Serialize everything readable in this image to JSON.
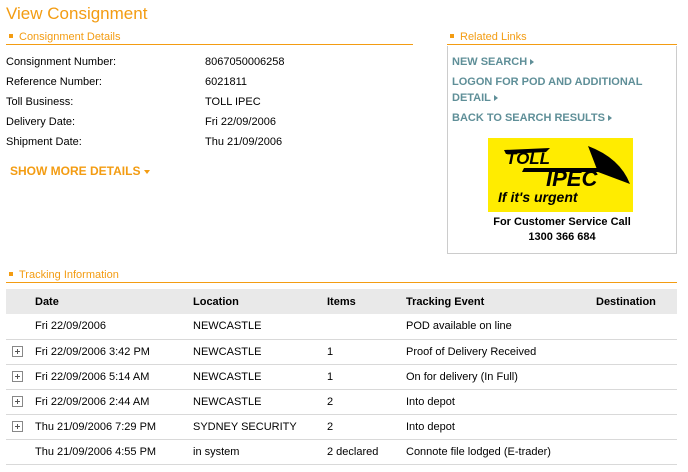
{
  "page_title": "View Consignment",
  "consignment_section": {
    "heading": "Consignment Details",
    "fields": [
      {
        "label": "Consignment Number:",
        "value": "8067050006258"
      },
      {
        "label": "Reference Number:",
        "value": "6021811"
      },
      {
        "label": "Toll Business:",
        "value": "TOLL IPEC"
      },
      {
        "label": "Delivery Date:",
        "value": "Fri 22/09/2006"
      },
      {
        "label": "Shipment Date:",
        "value": "Thu 21/09/2006"
      }
    ],
    "show_more_label": "SHOW MORE DETAILS"
  },
  "related_links": {
    "heading": "Related Links",
    "links": [
      {
        "label": "NEW SEARCH"
      },
      {
        "label_line1": "LOGON FOR POD AND ADDITIONAL",
        "label_line2": "DETAIL"
      },
      {
        "label": "BACK TO SEARCH RESULTS"
      }
    ],
    "logo": {
      "line1": "TOLL",
      "line2": "IPEC",
      "tagline": "If it's urgent"
    },
    "customer_service_label": "For Customer Service Call",
    "customer_service_phone": "1300 366 684"
  },
  "tracking_section": {
    "heading": "Tracking Information",
    "columns": [
      "Date",
      "Location",
      "Items",
      "Tracking Event",
      "Destination"
    ],
    "rows": [
      {
        "expandable": false,
        "date": "Fri 22/09/2006",
        "location": "NEWCASTLE",
        "items": "",
        "event": "POD available on line",
        "destination": ""
      },
      {
        "expandable": true,
        "date": "Fri 22/09/2006 3:42 PM",
        "location": "NEWCASTLE",
        "items": "1",
        "event": "Proof of Delivery Received",
        "destination": ""
      },
      {
        "expandable": true,
        "date": "Fri 22/09/2006 5:14 AM",
        "location": "NEWCASTLE",
        "items": "1",
        "event": "On for delivery (In Full)",
        "destination": ""
      },
      {
        "expandable": true,
        "date": "Fri 22/09/2006 2:44 AM",
        "location": "NEWCASTLE",
        "items": "2",
        "event": "Into depot",
        "destination": ""
      },
      {
        "expandable": true,
        "date": "Thu 21/09/2006 7:29 PM",
        "location": "SYDNEY SECURITY",
        "items": "2",
        "event": "Into depot",
        "destination": ""
      },
      {
        "expandable": false,
        "date": "Thu 21/09/2006 4:55 PM",
        "location": "in system",
        "items": "2 declared",
        "event": "Connote file lodged (E-trader)",
        "destination": ""
      }
    ]
  },
  "colors": {
    "accent": "#f39c12",
    "link": "#5f8f98",
    "logo_bg": "#ffec00",
    "header_bg": "#e9e9e9"
  }
}
